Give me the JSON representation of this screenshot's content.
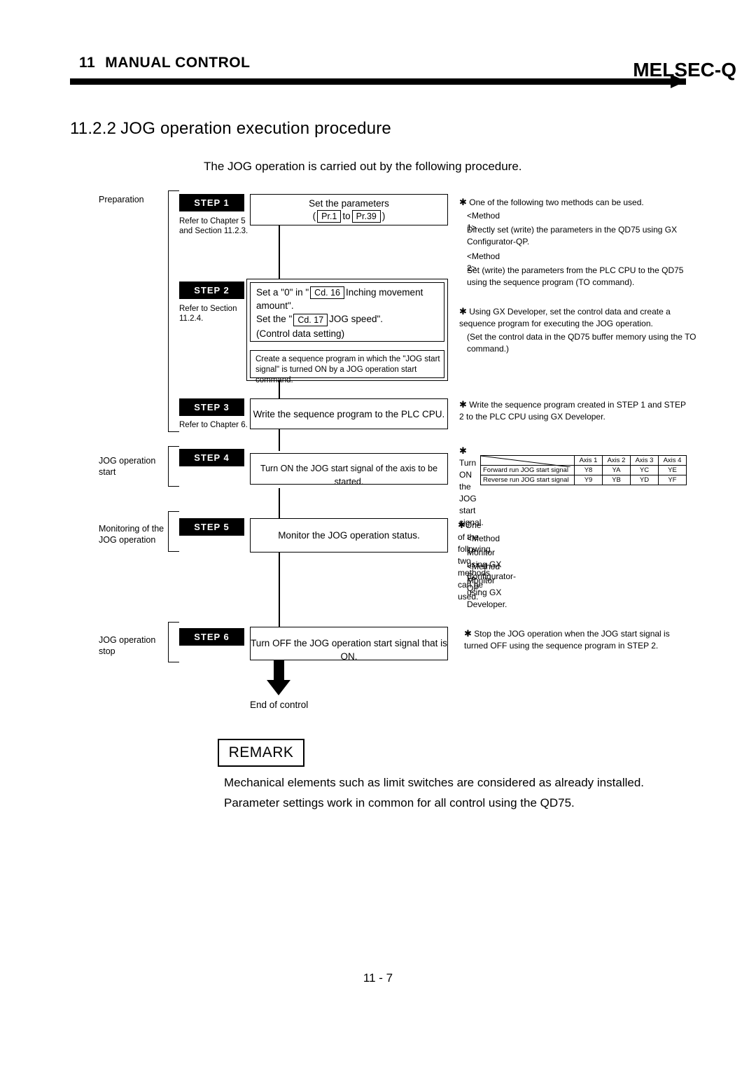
{
  "header": {
    "chapter_number": "11",
    "chapter_title": "MANUAL CONTROL",
    "brand": "MELSEC-Q"
  },
  "section": {
    "number": "11.2.2",
    "title": "JOG operation execution procedure",
    "intro": "The JOG operation is carried out by the following procedure."
  },
  "left_labels": {
    "preparation": "Preparation",
    "jog_start": "JOG operation\nstart",
    "monitoring": "Monitoring of the\nJOG operation",
    "jog_stop": "JOG operation\nstop"
  },
  "steps": [
    {
      "badge": "STEP 1",
      "ref": "Refer to Chapter 5\nand Section 11.2.3.",
      "box_title": "Set the parameters",
      "box_sub_open": "(",
      "box_sub_pr1": "Pr.1",
      "box_sub_to": "to",
      "box_sub_pr39": "Pr.39",
      "box_sub_close": ")",
      "notes": [
        "One of the following two methods can be used.",
        "<Method 1>",
        "Directly set (write) the parameters in the QD75 using GX Configurator-QP.",
        "<Method 2>",
        "Set (write) the parameters from the PLC CPU to the QD75 using the sequence program (TO command)."
      ]
    },
    {
      "badge": "STEP 2",
      "ref": "Refer to Section\n11.2.4.",
      "box_line1_a": "Set a \"0\" in \"",
      "box_cd16": "Cd. 16",
      "box_line1_b": "Inching movement",
      "box_line2": "amount\".",
      "box_line3_a": "Set the \"",
      "box_cd17": "Cd. 17",
      "box_line3_b": "JOG speed\".",
      "box_line4": "(Control data setting)",
      "box2_line1": "Create a sequence program in which the \"JOG start",
      "box2_line2": "signal\" is turned ON by a JOG operation start command.",
      "notes": [
        "Using GX Developer, set the control data and create a sequence program for executing the JOG operation.",
        "(Set the control data in the QD75 buffer memory using the TO command.)"
      ]
    },
    {
      "badge": "STEP 3",
      "ref": "Refer to Chapter 6.",
      "box_title": "Write the sequence program to the PLC CPU.",
      "notes": [
        "Write the sequence program created in STEP 1 and STEP 2 to the PLC CPU using GX Developer."
      ]
    },
    {
      "badge": "STEP 4",
      "ref": "",
      "box_title": "Turn ON the JOG start signal of the axis to be started.",
      "notes": [
        "Turn ON the JOG start signal."
      ]
    },
    {
      "badge": "STEP 5",
      "ref": "",
      "box_title": "Monitor the JOG operation status.",
      "notes": [
        "One of the following two methods can be used.",
        "<Method 1>",
        "Monitor using GX Configurator-QP.",
        "<Method 2>",
        "Monitor using GX Developer."
      ]
    },
    {
      "badge": "STEP 6",
      "ref": "",
      "box_title": "Turn OFF the JOG operation start signal that is ON.",
      "notes": [
        "Stop the JOG operation when the JOG start signal is turned OFF using the sequence program in STEP 2."
      ]
    }
  ],
  "signal_table": {
    "headers": [
      "Axis 1",
      "Axis 2",
      "Axis 3",
      "Axis 4"
    ],
    "rows": [
      {
        "label": "Forward run JOG start signal",
        "values": [
          "Y8",
          "YA",
          "YC",
          "YE"
        ]
      },
      {
        "label": "Reverse run JOG start signal",
        "values": [
          "Y9",
          "YB",
          "YD",
          "YF"
        ]
      }
    ]
  },
  "end_of_control": "End of control",
  "remark": {
    "title": "REMARK",
    "line1": "Mechanical elements such as limit switches are considered as already installed.",
    "line2": "Parameter settings work in common for all control using the QD75."
  },
  "page_number": "11 - 7"
}
